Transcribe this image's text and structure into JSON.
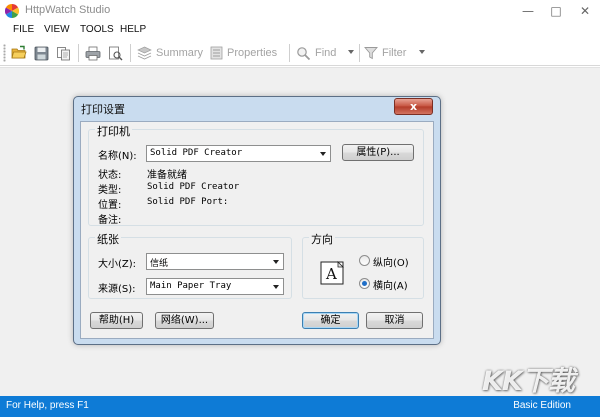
{
  "app": {
    "title": "HttpWatch Studio",
    "accent": "#0e7bd6"
  },
  "window_controls": {
    "minimize": "—",
    "maximize": "□",
    "close": "✕"
  },
  "menu": [
    "FILE",
    "VIEW",
    "TOOLS",
    "HELP"
  ],
  "toolbar": {
    "summary_label": "Summary",
    "properties_label": "Properties",
    "find_label": "Find",
    "filter_label": "Filter"
  },
  "status": {
    "left": "For Help, press F1",
    "right": "Basic Edition"
  },
  "watermark": "KK下载",
  "dialog": {
    "title": "打印设置",
    "close_glyph": "x",
    "printer": {
      "legend": "打印机",
      "name_label": "名称(N):",
      "name_value": "Solid PDF Creator",
      "properties_button": "属性(P)...",
      "status_label": "状态:",
      "status_value": "准备就绪",
      "type_label": "类型:",
      "type_value": "Solid PDF Creator",
      "where_label": "位置:",
      "where_value": "Solid PDF Port:",
      "comment_label": "备注:"
    },
    "paper": {
      "legend": "纸张",
      "size_label": "大小(Z):",
      "size_value": "信纸",
      "source_label": "来源(S):",
      "source_value": "Main Paper Tray"
    },
    "orientation": {
      "legend": "方向",
      "portrait_label": "纵向(O)",
      "landscape_label": "横向(A)",
      "selected": "landscape",
      "icon_letter": "A"
    },
    "buttons": {
      "help": "帮助(H)",
      "network": "网络(W)...",
      "ok": "确定",
      "cancel": "取消"
    }
  }
}
